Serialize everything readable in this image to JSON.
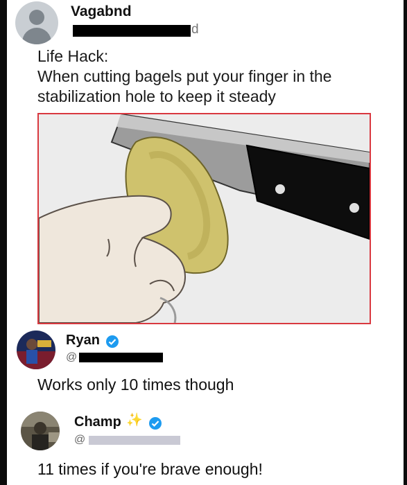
{
  "post": {
    "author_name": "Vagabnd",
    "handle_suffix": "d",
    "text_line_1": "Life Hack:",
    "text_line_2": "When cutting bagels put your finger in the",
    "text_line_3": "stabilization hole to keep it steady"
  },
  "replies": [
    {
      "name": "Ryan",
      "handle_prefix": "@",
      "text": "Works only 10 times though",
      "verified": true
    },
    {
      "name": "Champ",
      "handle_prefix": "@",
      "text": "11 times if you're brave enough!",
      "verified": true,
      "emoji": "sparkles-icon"
    }
  ],
  "colors": {
    "verified_blue": "#1d9bf0",
    "image_border": "#d9383f",
    "redaction": "#000000"
  }
}
